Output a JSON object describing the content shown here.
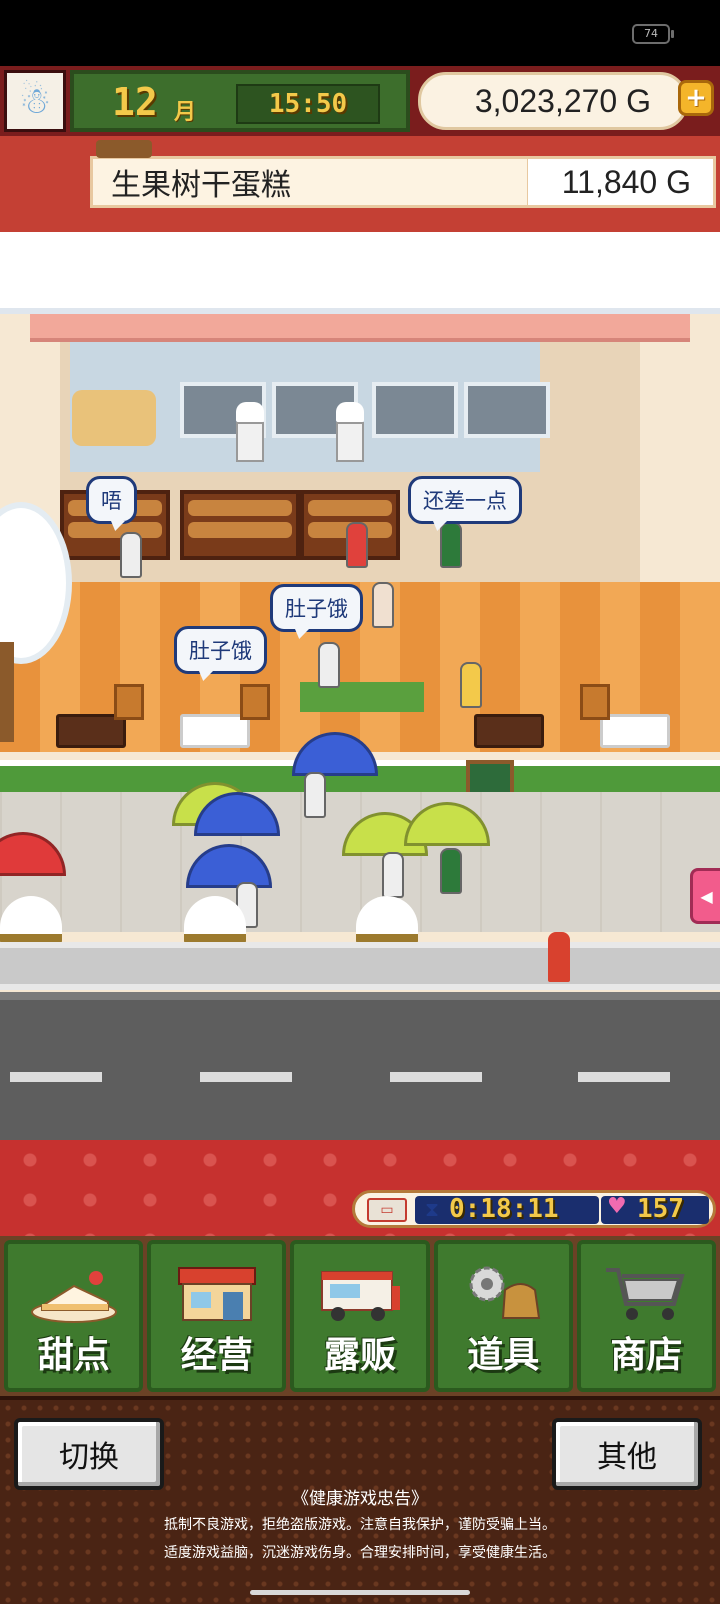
{
  "status_bar": {
    "battery": "74"
  },
  "hud": {
    "month": "12",
    "month_unit": "月",
    "time": "15:50",
    "money": "3,023,270 G",
    "add_money_label": "+"
  },
  "product": {
    "name": "生果树干蛋糕",
    "price": "11,840 G"
  },
  "scene": {
    "bubbles": [
      "唔",
      "还差一点",
      "肚子饿",
      "肚子饿"
    ]
  },
  "food_truck": {
    "timer": "0:18:11",
    "hearts": "157"
  },
  "menu": [
    {
      "label": "甜点",
      "icon": "cake-icon"
    },
    {
      "label": "经营",
      "icon": "shop-building-icon"
    },
    {
      "label": "露贩",
      "icon": "food-truck-icon"
    },
    {
      "label": "道具",
      "icon": "gear-sack-icon"
    },
    {
      "label": "商店",
      "icon": "shopping-cart-icon"
    }
  ],
  "bottom": {
    "switch_label": "切换",
    "other_label": "其他",
    "notice_title": "《健康游戏忠告》",
    "notice_line1": "抵制不良游戏，拒绝盗版游戏。注意自我保护，谨防受骗上当。",
    "notice_line2": "适度游戏益脑，沉迷游戏伤身。合理安排时间，享受健康生活。"
  },
  "colors": {
    "hud_green": "#3d6e2c",
    "gold_text": "#f3c94a",
    "menu_green": "#3f7a2e",
    "banner_red": "#c44034"
  }
}
